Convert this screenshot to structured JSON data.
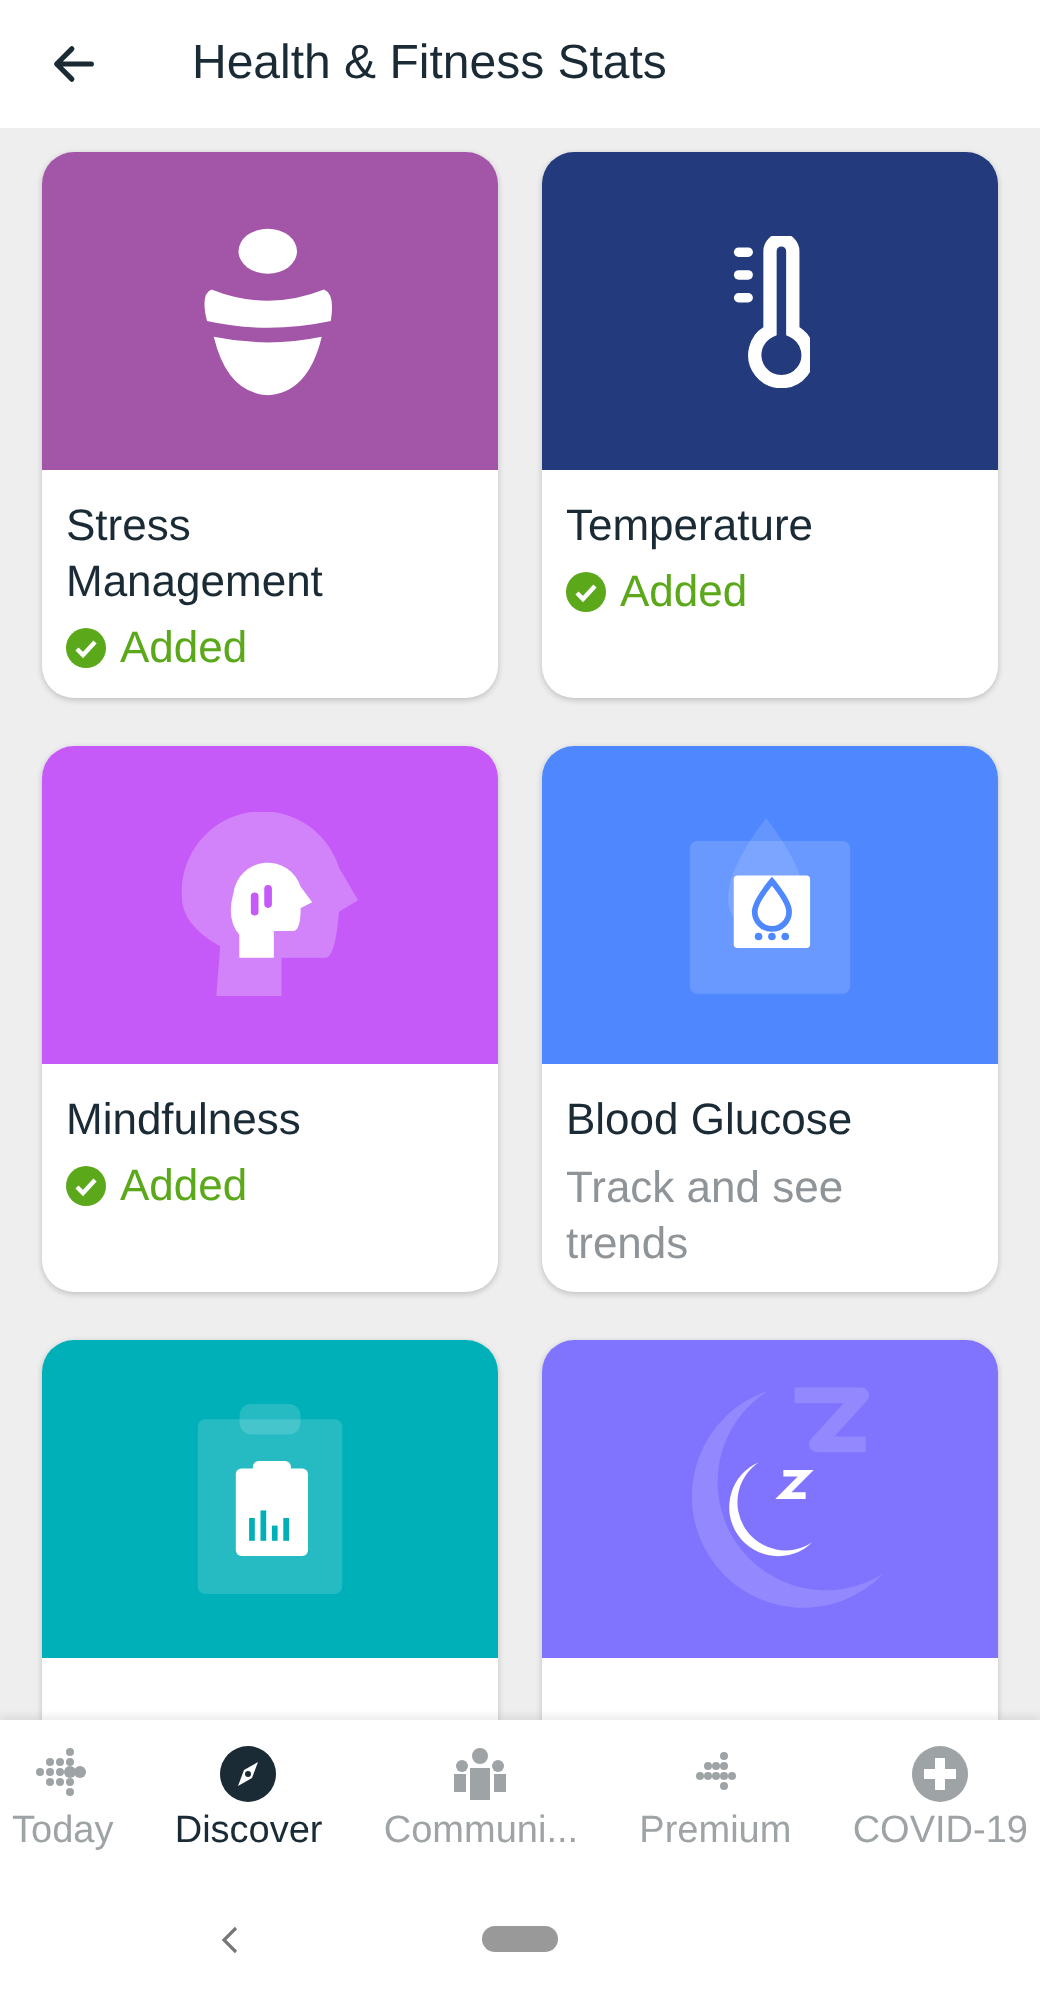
{
  "header": {
    "title": "Health & Fitness Stats"
  },
  "cards": [
    {
      "title": "Stress Management",
      "color": "#a356a8",
      "added": true,
      "status": "Added"
    },
    {
      "title": "Temperature",
      "color": "#233a7c",
      "added": true,
      "status": "Added"
    },
    {
      "title": "Mindfulness",
      "color": "#c55af9",
      "added": true,
      "status": "Added"
    },
    {
      "title": "Blood Glucose",
      "color": "#4f88fe",
      "added": false,
      "status": "Track and see trends"
    },
    {
      "color": "#00b0b9"
    },
    {
      "color": "#8074fe"
    }
  ],
  "nav": [
    {
      "label": "Today",
      "selected": false
    },
    {
      "label": "Discover",
      "selected": true
    },
    {
      "label": "Communi...",
      "selected": false
    },
    {
      "label": "Premium",
      "selected": false
    },
    {
      "label": "COVID-19",
      "selected": false
    }
  ]
}
